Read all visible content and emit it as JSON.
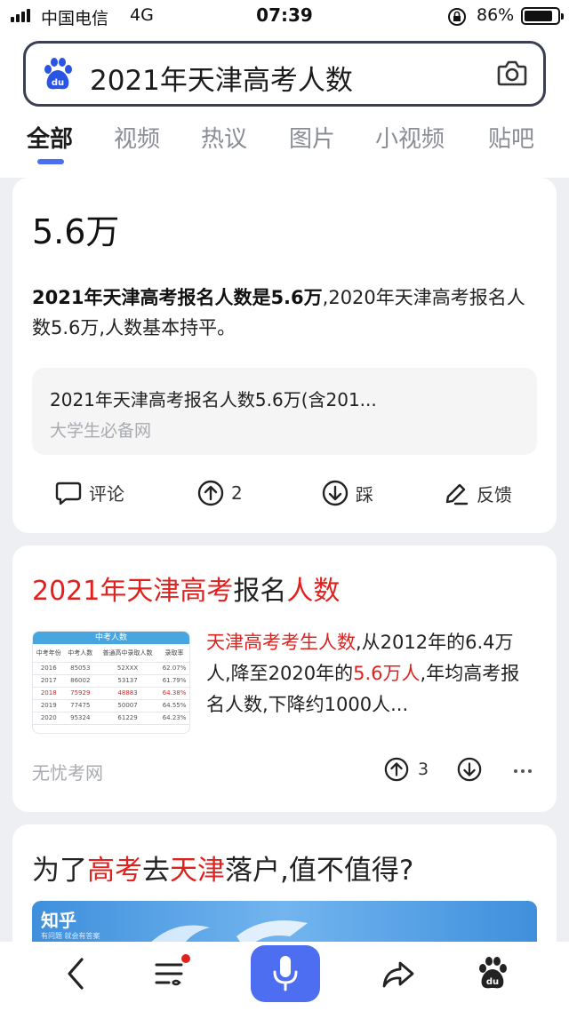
{
  "status_bar": {
    "carrier": "中国电信",
    "network": "4G",
    "time": "07:39",
    "battery_pct": "86%",
    "battery_level": 0.86
  },
  "search": {
    "query": "2021年天津高考人数",
    "logo_text": "du"
  },
  "tabs": [
    {
      "label": "全部",
      "active": true
    },
    {
      "label": "视频"
    },
    {
      "label": "热议"
    },
    {
      "label": "图片"
    },
    {
      "label": "小视频"
    },
    {
      "label": "贴吧"
    }
  ],
  "answer_card": {
    "answer": "5.6万",
    "summary_bold": "2021年天津高考报名人数是5.6万",
    "summary_rest": ",2020年天津高考报名人数5.6万,人数基本持平。",
    "source_title": "2021年天津高考报名人数5.6万(含201...",
    "source_site": "大学生必备网",
    "actions": {
      "comment": "评论",
      "upvote_count": "2",
      "downvote": "踩",
      "feedback": "反馈"
    }
  },
  "result1": {
    "title_parts": [
      {
        "text": "2021年天津高考",
        "hl": true
      },
      {
        "text": "报名",
        "hl": false
      },
      {
        "text": "人数",
        "hl": true
      }
    ],
    "snippet_parts": [
      {
        "text": "天津高考考生人数",
        "hl": true
      },
      {
        "text": ",从2012年的6.4万人,降至2020年的",
        "hl": false
      },
      {
        "text": "5.6万人",
        "hl": true
      },
      {
        "text": ",年均高考报名人数,下降约1000人...",
        "hl": false
      }
    ],
    "source": "无忧考网",
    "upvote_count": "3",
    "thumbnail": {
      "caption": "中考人数",
      "headers": [
        "中考年份",
        "中考人数",
        "普通高中录取人数",
        "录取率"
      ],
      "rows": [
        [
          "2016",
          "85053",
          "52XXX",
          "62.07%"
        ],
        [
          "2017",
          "86002",
          "53137",
          "61.79%"
        ],
        [
          "2018",
          "75929",
          "48883",
          "64.38%"
        ],
        [
          "2019",
          "77475",
          "50007",
          "64.55%"
        ],
        [
          "2020",
          "95324",
          "61229",
          "64.23%"
        ]
      ],
      "highlight_row": 2
    }
  },
  "result2": {
    "title_parts": [
      {
        "text": "为了",
        "hl": false
      },
      {
        "text": "高考",
        "hl": true
      },
      {
        "text": "去",
        "hl": false
      },
      {
        "text": "天津",
        "hl": true
      },
      {
        "text": "落户,值不值得?",
        "hl": false
      }
    ],
    "banner_brand": "知乎",
    "banner_sub": "有问题 就会有答案"
  },
  "colors": {
    "accent": "#4e6ef2",
    "highlight": "#e0221f",
    "source_gray": "#a9abb1"
  }
}
